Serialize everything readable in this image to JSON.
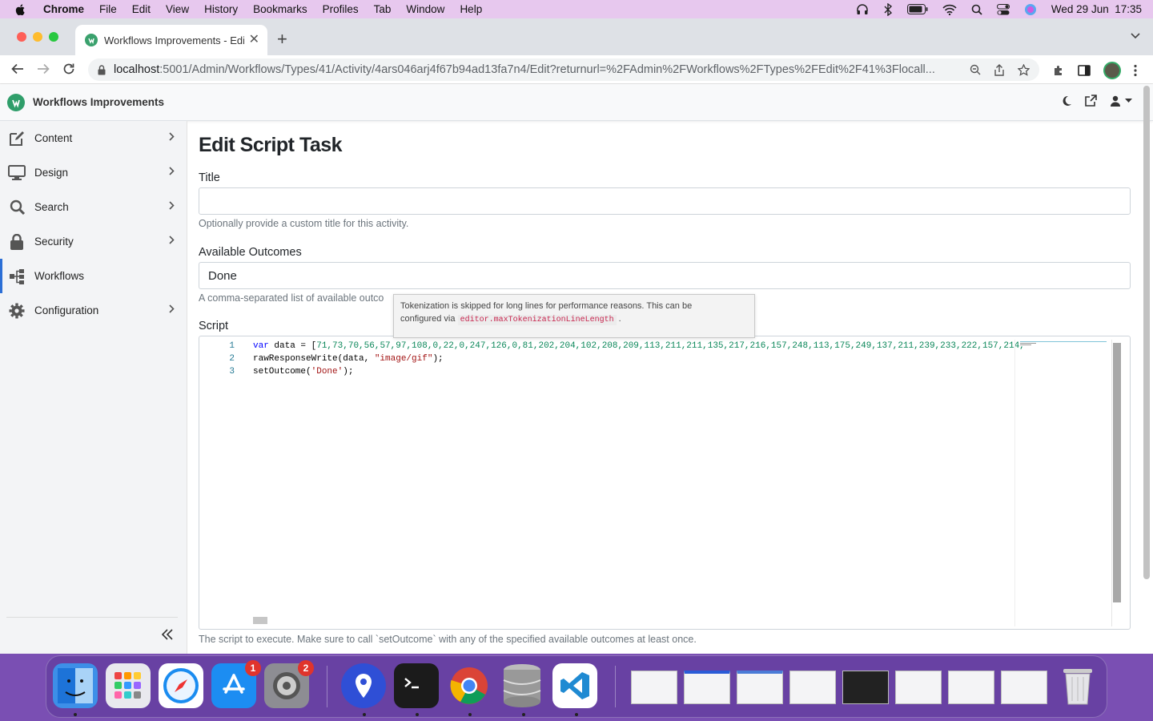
{
  "menubar": {
    "app": "Chrome",
    "items": [
      "File",
      "Edit",
      "View",
      "History",
      "Bookmarks",
      "Profiles",
      "Tab",
      "Window",
      "Help"
    ],
    "clock": "Wed 29 Jun  17:35"
  },
  "browser": {
    "tab_title": "Workflows Improvements - Edit",
    "url_host": "localhost",
    "url_path": ":5001/Admin/Workflows/Types/41/Activity/4ars046arj4f67b94ad13fa7n4/Edit?returnurl=%2FAdmin%2FWorkflows%2FTypes%2FEdit%2F41%3Flocall..."
  },
  "app": {
    "brand": "Workflows Improvements"
  },
  "sidebar": {
    "items": [
      {
        "label": "Content",
        "icon": "edit-icon",
        "has_chevron": true
      },
      {
        "label": "Design",
        "icon": "monitor-icon",
        "has_chevron": true
      },
      {
        "label": "Search",
        "icon": "search-icon",
        "has_chevron": true
      },
      {
        "label": "Security",
        "icon": "lock-icon",
        "has_chevron": true
      },
      {
        "label": "Workflows",
        "icon": "workflow-icon",
        "has_chevron": false,
        "active": true
      },
      {
        "label": "Configuration",
        "icon": "gear-icon",
        "has_chevron": true
      }
    ]
  },
  "form": {
    "heading": "Edit Script Task",
    "title_label": "Title",
    "title_value": "",
    "title_hint": "Optionally provide a custom title for this activity.",
    "outcomes_label": "Available Outcomes",
    "outcomes_value": "Done",
    "outcomes_hint": "A comma-separated list of available outco",
    "script_label": "Script",
    "script_hint": "The script to execute. Make sure to call `setOutcome` with any of the specified available outcomes at least once."
  },
  "editor": {
    "line_numbers": [
      "1",
      "2",
      "3"
    ],
    "line1_kw": "var",
    "line1_rest": " data = [",
    "line1_numbers": "71,73,70,56,57,97,108,0,22,0,247,126,0,81,202,204,102,208,209,113,211,211,135,217,216,157,248,113,175,249,137,211,239,233,222,157,214,",
    "line2_pre": "rawResponseWrite(data, ",
    "line2_str": "\"image/gif\"",
    "line2_post": ");",
    "line3_pre": "setOutcome(",
    "line3_str": "'Done'",
    "line3_post": ");"
  },
  "tooltip": {
    "text1": "Tokenization is skipped for long lines for performance reasons. This can be",
    "text2": "configured via",
    "code": "editor.maxTokenizationLineLength",
    "text3": "."
  },
  "dock": {
    "badges": {
      "app_store": "1",
      "system_prefs": "2"
    }
  },
  "colors": {
    "accent": "#2c6fd6",
    "brand": "#2f9e6a",
    "menubar": "#e7c8ee"
  }
}
